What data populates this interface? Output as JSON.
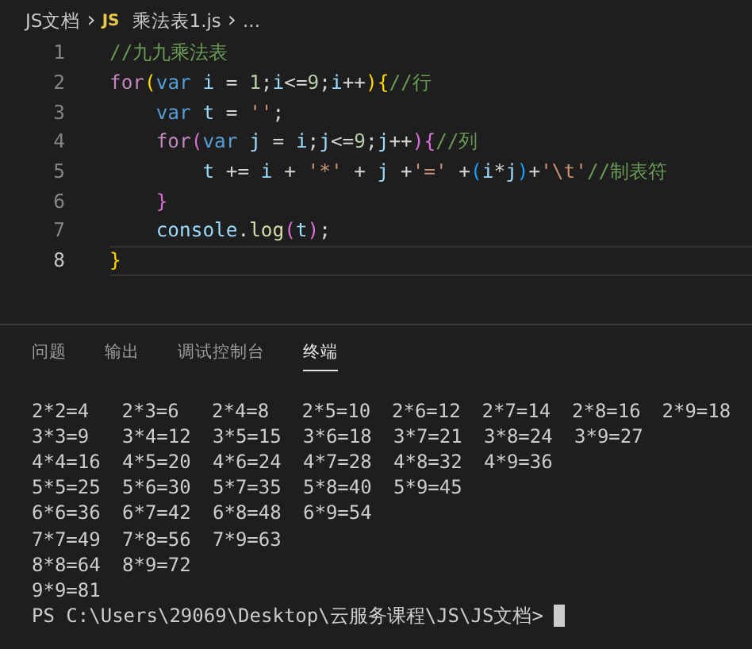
{
  "breadcrumb": [
    {
      "text": "JS文档",
      "kind": "folder"
    },
    {
      "text": "JS",
      "kind": "file-badge"
    },
    {
      "text": "乘法表1.js",
      "kind": "file"
    },
    {
      "text": "...",
      "kind": "symbol"
    }
  ],
  "breadcrumb_separator": "›",
  "code_lines": [
    {
      "number": "1",
      "active": false,
      "tokens": [
        {
          "text": "//九九乘法表",
          "kind": "comment"
        }
      ]
    },
    {
      "number": "2",
      "active": false,
      "tokens": [
        {
          "text": "for",
          "kind": "control"
        },
        {
          "text": "(",
          "kind": "bracket1"
        },
        {
          "text": "var",
          "kind": "storage"
        },
        {
          "text": " i ",
          "kind": "variable"
        },
        {
          "text": "= ",
          "kind": "plain"
        },
        {
          "text": "1",
          "kind": "number"
        },
        {
          "text": ";",
          "kind": "plain"
        },
        {
          "text": "i",
          "kind": "variable"
        },
        {
          "text": "<=",
          "kind": "plain"
        },
        {
          "text": "9",
          "kind": "number"
        },
        {
          "text": ";",
          "kind": "plain"
        },
        {
          "text": "i",
          "kind": "variable"
        },
        {
          "text": "++",
          "kind": "plain"
        },
        {
          "text": ")",
          "kind": "bracket1"
        },
        {
          "text": "{",
          "kind": "bracket1"
        },
        {
          "text": "//行",
          "kind": "comment"
        }
      ]
    },
    {
      "number": "3",
      "active": false,
      "tokens": [
        {
          "text": "    var",
          "kind": "storage"
        },
        {
          "text": " t ",
          "kind": "variable"
        },
        {
          "text": "= ",
          "kind": "plain"
        },
        {
          "text": "''",
          "kind": "string"
        },
        {
          "text": ";",
          "kind": "plain"
        }
      ]
    },
    {
      "number": "4",
      "active": false,
      "tokens": [
        {
          "text": "    for",
          "kind": "control"
        },
        {
          "text": "(",
          "kind": "bracket2"
        },
        {
          "text": "var",
          "kind": "storage"
        },
        {
          "text": " j ",
          "kind": "variable"
        },
        {
          "text": "= ",
          "kind": "plain"
        },
        {
          "text": "i",
          "kind": "variable"
        },
        {
          "text": ";",
          "kind": "plain"
        },
        {
          "text": "j",
          "kind": "variable"
        },
        {
          "text": "<=",
          "kind": "plain"
        },
        {
          "text": "9",
          "kind": "number"
        },
        {
          "text": ";",
          "kind": "plain"
        },
        {
          "text": "j",
          "kind": "variable"
        },
        {
          "text": "++",
          "kind": "plain"
        },
        {
          "text": ")",
          "kind": "bracket2"
        },
        {
          "text": "{",
          "kind": "bracket2"
        },
        {
          "text": "//列",
          "kind": "comment"
        }
      ]
    },
    {
      "number": "5",
      "active": false,
      "tokens": [
        {
          "text": "        t",
          "kind": "variable"
        },
        {
          "text": " += ",
          "kind": "plain"
        },
        {
          "text": "i",
          "kind": "variable"
        },
        {
          "text": " + ",
          "kind": "plain"
        },
        {
          "text": "'*'",
          "kind": "string"
        },
        {
          "text": " + ",
          "kind": "plain"
        },
        {
          "text": "j",
          "kind": "variable"
        },
        {
          "text": " +",
          "kind": "plain"
        },
        {
          "text": "'='",
          "kind": "string"
        },
        {
          "text": " +",
          "kind": "plain"
        },
        {
          "text": "(",
          "kind": "bracket3"
        },
        {
          "text": "i",
          "kind": "variable"
        },
        {
          "text": "*",
          "kind": "plain"
        },
        {
          "text": "j",
          "kind": "variable"
        },
        {
          "text": ")",
          "kind": "bracket3"
        },
        {
          "text": "+",
          "kind": "plain"
        },
        {
          "text": "'\\t'",
          "kind": "string"
        },
        {
          "text": "//制表符",
          "kind": "comment"
        }
      ]
    },
    {
      "number": "6",
      "active": false,
      "tokens": [
        {
          "text": "    }",
          "kind": "bracket2"
        }
      ]
    },
    {
      "number": "7",
      "active": false,
      "tokens": [
        {
          "text": "    console",
          "kind": "variable"
        },
        {
          "text": ".",
          "kind": "plain"
        },
        {
          "text": "log",
          "kind": "function"
        },
        {
          "text": "(",
          "kind": "bracket2"
        },
        {
          "text": "t",
          "kind": "variable"
        },
        {
          "text": ")",
          "kind": "bracket2"
        },
        {
          "text": ";",
          "kind": "plain"
        }
      ]
    },
    {
      "number": "8",
      "active": true,
      "tokens": [
        {
          "text": "}",
          "kind": "bracket1"
        }
      ]
    }
  ],
  "panel_tabs": [
    {
      "label": "问题",
      "selected": false
    },
    {
      "label": "输出",
      "selected": false
    },
    {
      "label": "调试控制台",
      "selected": false
    },
    {
      "label": "终端",
      "selected": true
    }
  ],
  "terminal_rows": [
    [
      "2*2=4",
      "2*3=6",
      "2*4=8",
      "2*5=10",
      "2*6=12",
      "2*7=14",
      "2*8=16",
      "2*9=18"
    ],
    [
      "3*3=9",
      "3*4=12",
      "3*5=15",
      "3*6=18",
      "3*7=21",
      "3*8=24",
      "3*9=27"
    ],
    [
      "4*4=16",
      "4*5=20",
      "4*6=24",
      "4*7=28",
      "4*8=32",
      "4*9=36"
    ],
    [
      "5*5=25",
      "5*6=30",
      "5*7=35",
      "5*8=40",
      "5*9=45"
    ],
    [
      "6*6=36",
      "6*7=42",
      "6*8=48",
      "6*9=54"
    ],
    [
      "7*7=49",
      "7*8=56",
      "7*9=63"
    ],
    [
      "8*8=64",
      "8*9=72"
    ],
    [
      "9*9=81"
    ]
  ],
  "prompt": "PS C:\\Users\\29069\\Desktop\\云服务课程\\JS\\JS文档>"
}
